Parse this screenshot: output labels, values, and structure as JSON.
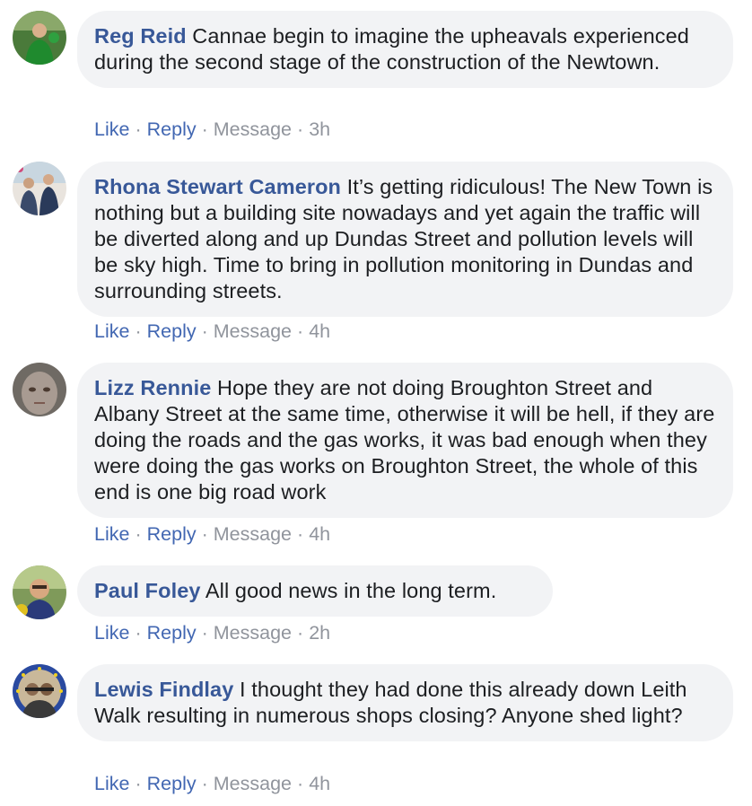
{
  "comments": [
    {
      "author": "Reg Reid",
      "text": "Cannae begin to imagine the upheavals experienced during the second stage of the construction of the Newtown.",
      "like": "Like",
      "reply": "Reply",
      "message": "Message",
      "time": "3h"
    },
    {
      "author": "Rhona Stewart Cameron",
      "text": "It’s getting ridiculous! The New Town is nothing but a building site nowadays and yet again the traffic will be diverted along and up Dundas Street and pollution levels will be sky high. Time to bring in pollution monitoring in Dundas and surrounding streets.",
      "like": "Like",
      "reply": "Reply",
      "message": "Message",
      "time": "4h"
    },
    {
      "author": "Lizz Rennie",
      "text": "Hope they are not doing Broughton Street and Albany Street at the same time, otherwise it will be hell, if they are doing the roads and the gas works, it was bad enough when they were doing the gas works on Broughton Street, the whole of this end is one big road work",
      "like": "Like",
      "reply": "Reply",
      "message": "Message",
      "time": "4h"
    },
    {
      "author": "Paul Foley",
      "text": "All good news in the long term.",
      "like": "Like",
      "reply": "Reply",
      "message": "Message",
      "time": "2h"
    },
    {
      "author": "Lewis Findlay",
      "text": "I thought they had done this already down Leith Walk resulting in numerous shops closing? Anyone shed light?",
      "like": "Like",
      "reply": "Reply",
      "message": "Message",
      "time": "4h"
    }
  ],
  "separator": "·",
  "colors": {
    "author": "#385898",
    "link": "#4267b2",
    "meta": "#90949c",
    "bubble": "#f2f3f5",
    "text": "#1c1e21"
  }
}
